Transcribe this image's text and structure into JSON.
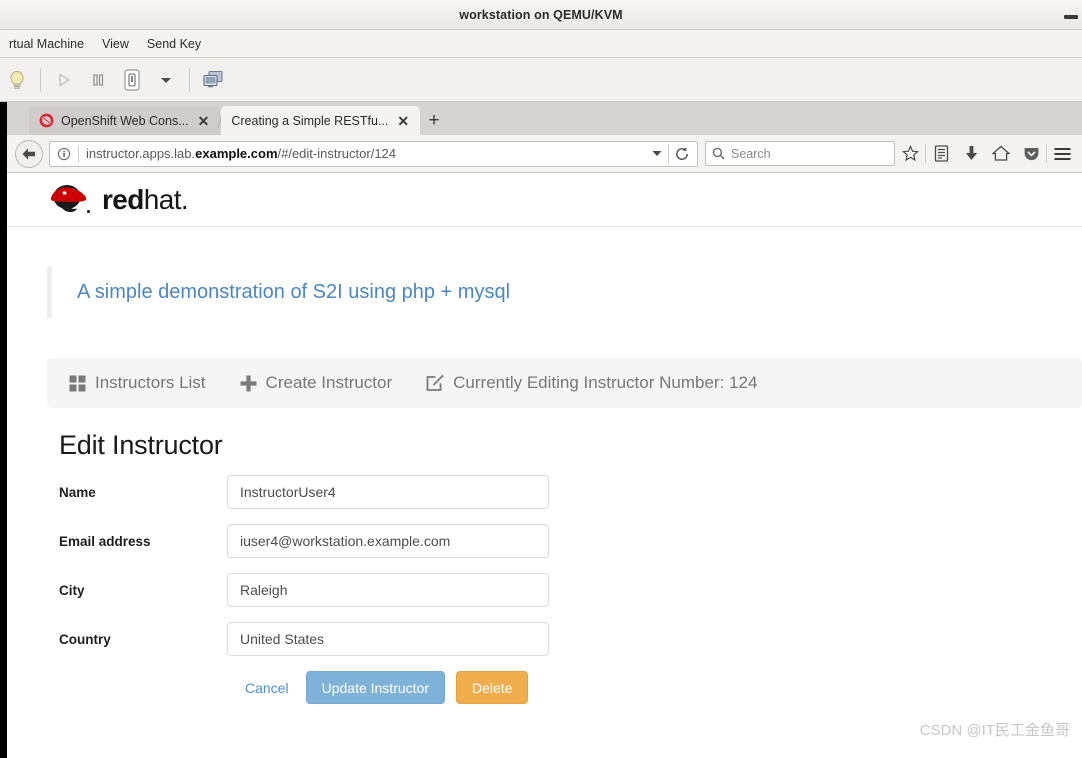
{
  "vm": {
    "title": "workstation on QEMU/KVM",
    "menus": [
      "rtual Machine",
      "View",
      "Send Key"
    ],
    "toolbar_icons": [
      "lightbulb-icon",
      "play-icon",
      "pause-icon",
      "shutdown-icon",
      "chevron-down-icon",
      "screenshot-icon"
    ]
  },
  "browser": {
    "tabs": [
      {
        "label": "OpenShift Web Cons...",
        "favicon": "openshift-favicon",
        "close": "✕",
        "active": false
      },
      {
        "label": "Creating a Simple RESTfu...",
        "favicon": "none",
        "close": "✕",
        "active": true
      }
    ],
    "newtab_label": "+",
    "url": {
      "prefix": "instructor.apps.lab.",
      "bold": "example.com",
      "suffix": "/#/edit-instructor/124"
    },
    "search_placeholder": "Search",
    "icons": [
      "back-icon",
      "identity-info-icon",
      "chevron-down-icon",
      "reload-icon",
      "search-icon",
      "bookmark-star-icon",
      "library-icon",
      "downloads-icon",
      "home-icon",
      "pocket-icon",
      "hamburger-menu-icon"
    ]
  },
  "page": {
    "brand": {
      "name_bold": "red",
      "name_light": "hat",
      "dot": "."
    },
    "lead": "A simple demonstration of S2I using php + mysql",
    "nav": [
      {
        "icon": "grid-icon",
        "label": "Instructors List"
      },
      {
        "icon": "plus-icon",
        "label": "Create Instructor"
      },
      {
        "icon": "edit-square-icon",
        "label": "Currently Editing Instructor Number: 124"
      }
    ],
    "form": {
      "title": "Edit Instructor",
      "fields": [
        {
          "label": "Name",
          "value": "InstructorUser4"
        },
        {
          "label": "Email address",
          "value": "iuser4@workstation.example.com"
        },
        {
          "label": "City",
          "value": "Raleigh"
        },
        {
          "label": "Country",
          "value": "United States"
        }
      ],
      "buttons": {
        "cancel": "Cancel",
        "update": "Update Instructor",
        "delete": "Delete"
      }
    },
    "watermark": "CSDN @IT民工金鱼哥"
  },
  "colors": {
    "accent_blue": "#4a87c4",
    "primary_button": "#7fb2d9",
    "warning_button": "#efad4e",
    "link_blue": "#4a90d9",
    "redhat_red": "#cc0000"
  }
}
